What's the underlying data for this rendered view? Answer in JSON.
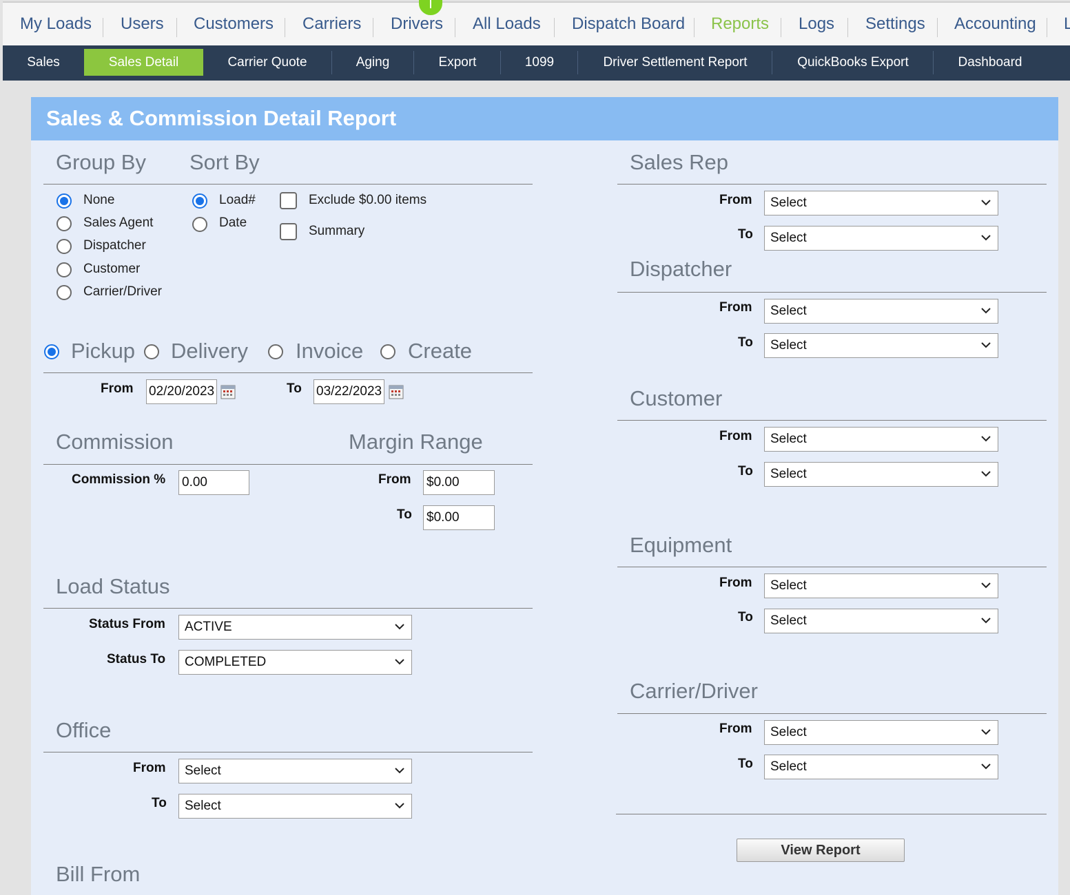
{
  "topnav": {
    "items": [
      "My Loads",
      "Users",
      "Customers",
      "Carriers",
      "Drivers",
      "All Loads",
      "Dispatch Board",
      "Reports",
      "Logs",
      "Settings",
      "Accounting",
      "L"
    ],
    "active": "Reports",
    "badge_color": "#7ed321"
  },
  "subnav": {
    "items": [
      "Sales",
      "Sales Detail",
      "Carrier Quote",
      "Aging",
      "Export",
      "1099",
      "Driver Settlement Report",
      "QuickBooks Export",
      "Dashboard"
    ],
    "active": "Sales Detail",
    "active_color": "#8cc63f"
  },
  "panel": {
    "title": "Sales & Commission Detail Report"
  },
  "group_by": {
    "title": "Group By",
    "options": [
      "None",
      "Sales Agent",
      "Dispatcher",
      "Customer",
      "Carrier/Driver"
    ],
    "selected": "None"
  },
  "sort_by": {
    "title": "Sort By",
    "options": [
      "Load#",
      "Date"
    ],
    "selected": "Load#"
  },
  "checkboxes": {
    "exclude_zero": "Exclude $0.00 items",
    "summary": "Summary"
  },
  "date_type": {
    "options": [
      "Pickup",
      "Delivery",
      "Invoice",
      "Create"
    ],
    "selected": "Pickup",
    "from_label": "From",
    "from_value": "02/20/2023",
    "to_label": "To",
    "to_value": "03/22/2023"
  },
  "commission": {
    "title": "Commission",
    "label": "Commission %",
    "value": "0.00"
  },
  "margin_range": {
    "title": "Margin Range",
    "from_label": "From",
    "from_value": "$0.00",
    "to_label": "To",
    "to_value": "$0.00"
  },
  "load_status": {
    "title": "Load Status",
    "from_label": "Status From",
    "from_value": "ACTIVE",
    "to_label": "Status To",
    "to_value": "COMPLETED"
  },
  "office": {
    "title": "Office",
    "from_label": "From",
    "from_value": "Select",
    "to_label": "To",
    "to_value": "Select"
  },
  "bill_from": {
    "title": "Bill From"
  },
  "sales_rep": {
    "title": "Sales Rep",
    "from_label": "From",
    "from_value": "Select",
    "to_label": "To",
    "to_value": "Select"
  },
  "dispatcher": {
    "title": "Dispatcher",
    "from_label": "From",
    "from_value": "Select",
    "to_label": "To",
    "to_value": "Select"
  },
  "customer": {
    "title": "Customer",
    "from_label": "From",
    "from_value": "Select",
    "to_label": "To",
    "to_value": "Select"
  },
  "equipment": {
    "title": "Equipment",
    "from_label": "From",
    "from_value": "Select",
    "to_label": "To",
    "to_value": "Select"
  },
  "carrier_driver": {
    "title": "Carrier/Driver",
    "from_label": "From",
    "from_value": "Select",
    "to_label": "To",
    "to_value": "Select"
  },
  "view_report_label": "View Report"
}
